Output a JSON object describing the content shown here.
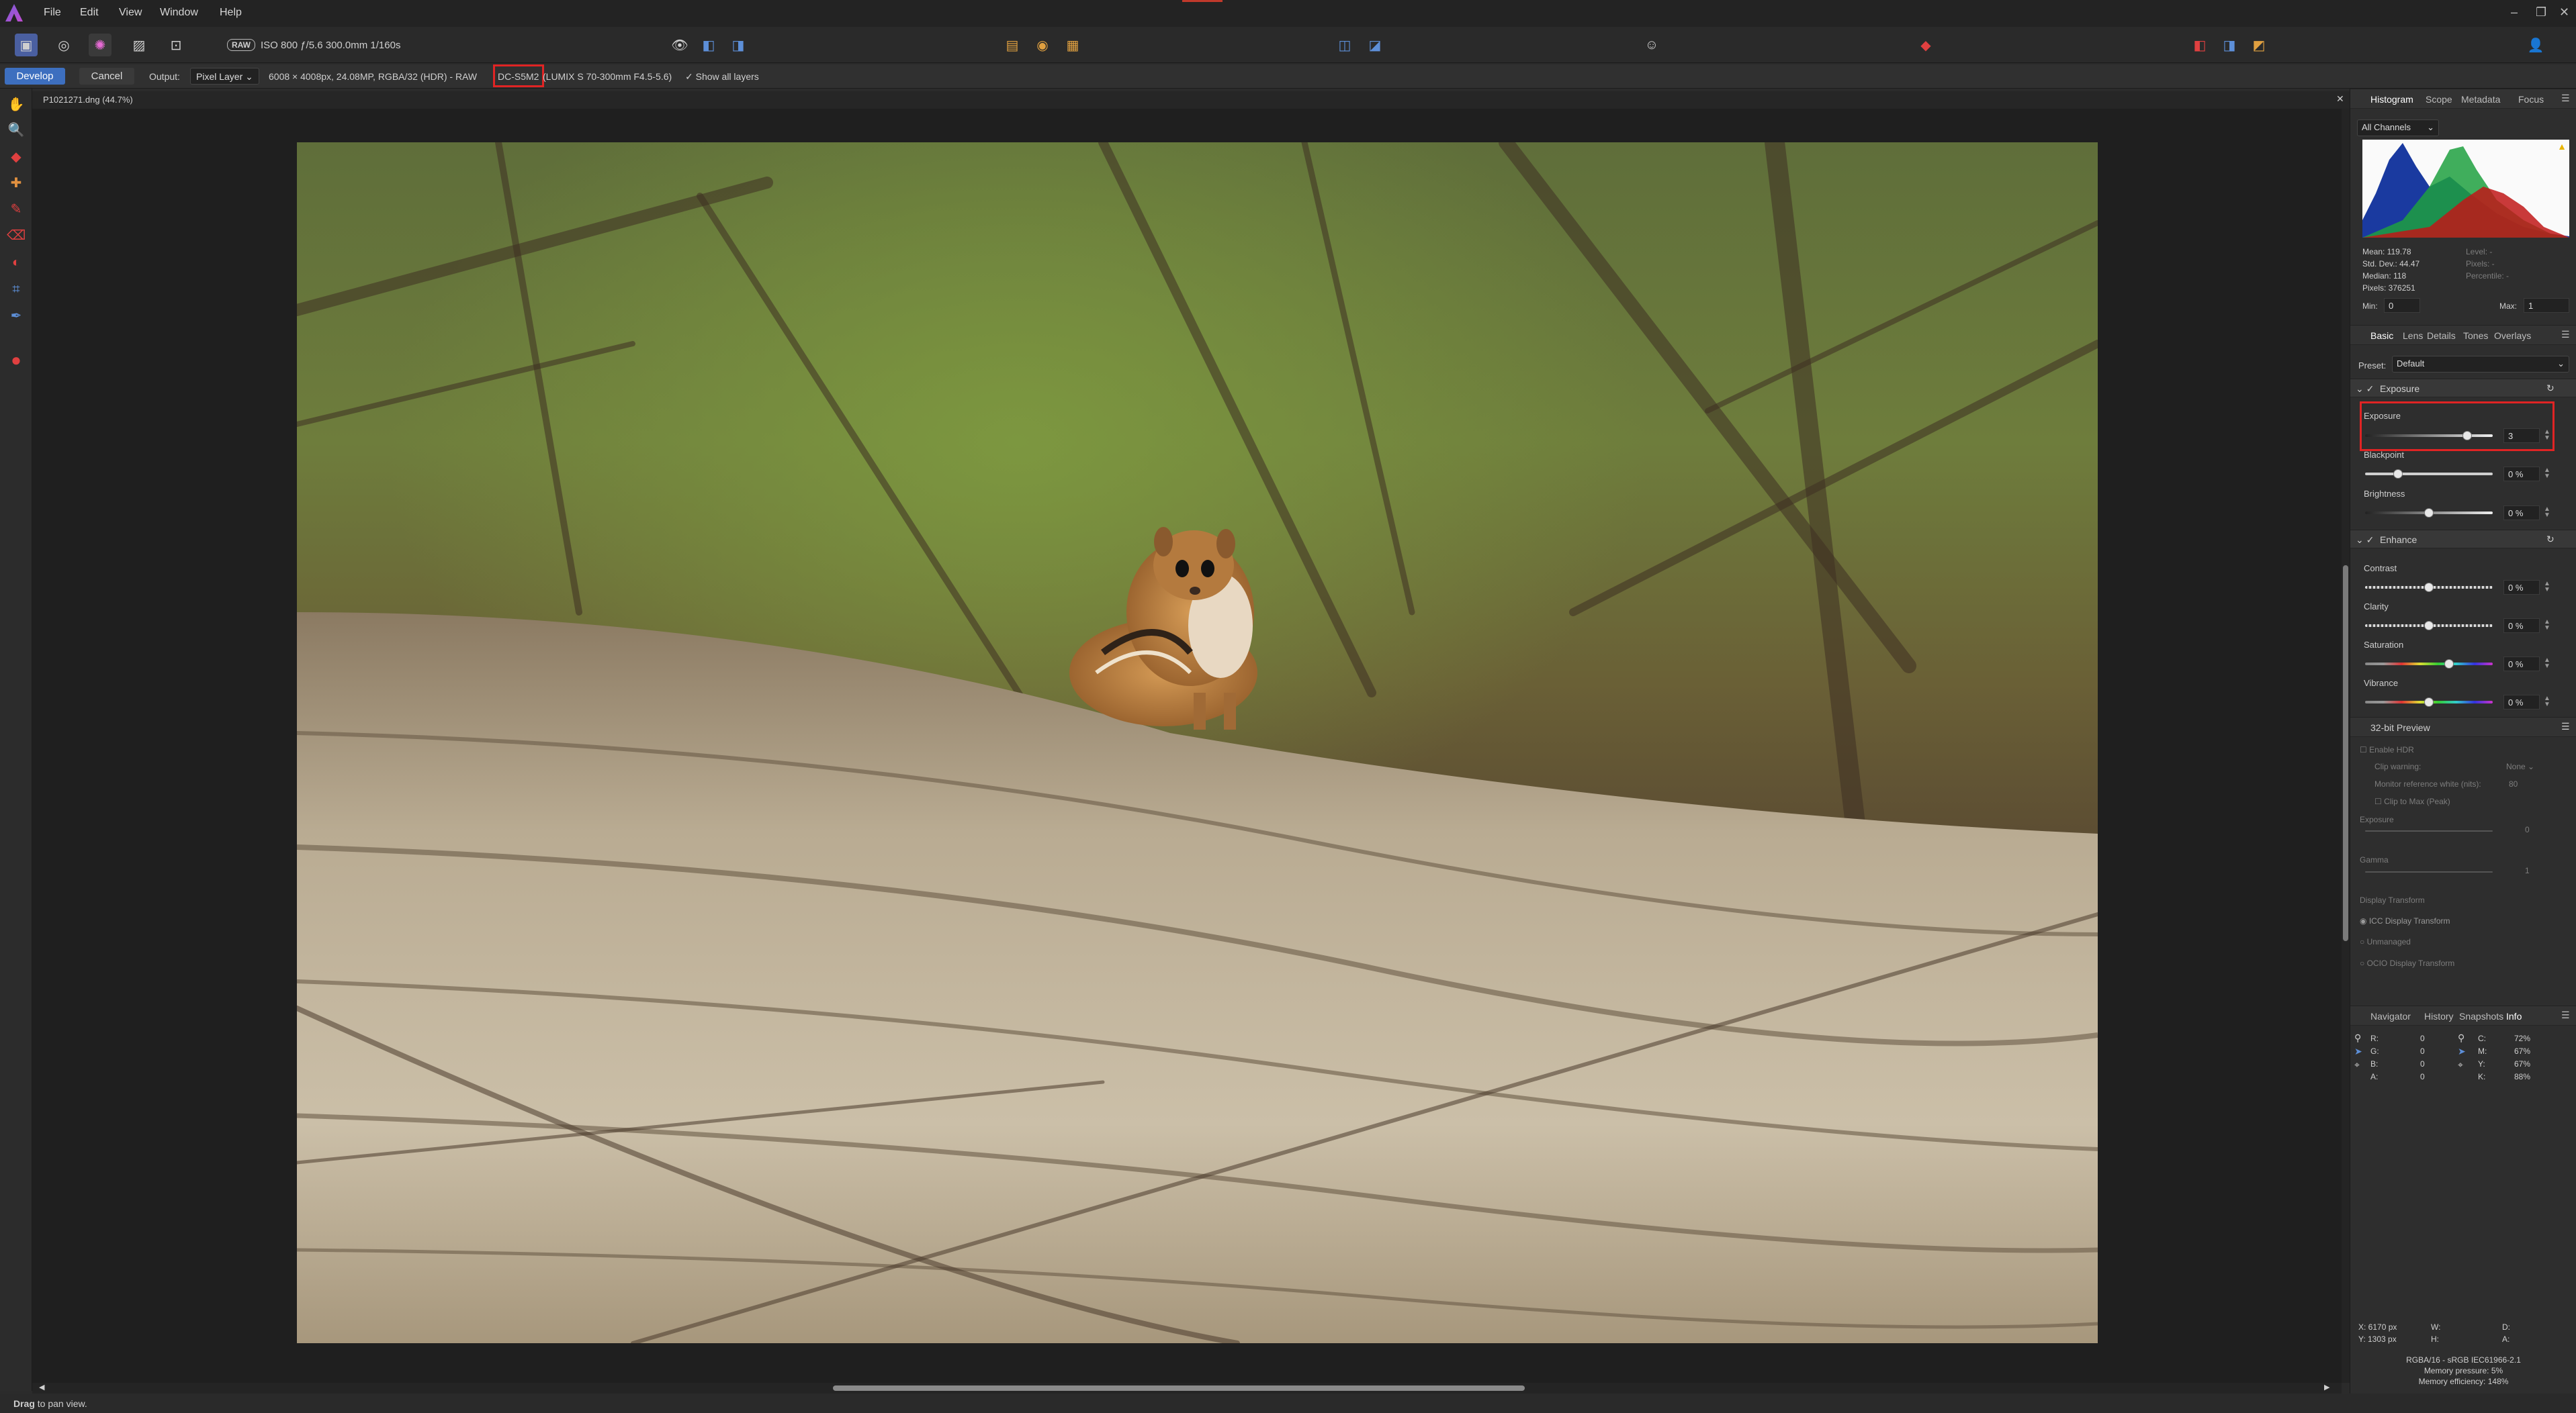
{
  "menu": {
    "items": [
      "File",
      "Edit",
      "View",
      "Window",
      "Help"
    ]
  },
  "toolbar": {
    "raw_badge": "RAW",
    "photo_info": "ISO 800 ƒ/5.6 300.0mm 1/160s"
  },
  "context": {
    "develop_label": "Develop",
    "cancel_label": "Cancel",
    "output_label": "Output:",
    "output_value": "Pixel Layer",
    "image_info": "6008 × 4008px, 24.08MP, RGBA/32 (HDR) - RAW",
    "camera_model": "DC-S5M2",
    "lens_info": "(LUMIX S 70-300mm F4.5-5.6)",
    "show_all_layers": "Show all layers"
  },
  "document": {
    "title": "P1021271.dng (44.7%)"
  },
  "histogram_panel": {
    "tabs": [
      "Histogram",
      "Scope",
      "Metadata",
      "Focus"
    ],
    "active_tab": "Histogram",
    "channel": "All Channels",
    "stats_left": [
      "Mean: 119.78",
      "Std. Dev.: 44.47",
      "Median: 118",
      "Pixels: 376251"
    ],
    "stats_right": [
      "Level: -",
      "Pixels: -",
      "Percentile: -"
    ],
    "min_label": "Min:",
    "min_value": "0",
    "max_label": "Max:",
    "max_value": "1"
  },
  "develop_panel": {
    "tabs": [
      "Basic",
      "Lens",
      "Details",
      "Tones",
      "Overlays"
    ],
    "active_tab": "Basic",
    "preset_label": "Preset:",
    "preset_value": "Default",
    "exposure_group": "Exposure",
    "exposure_label": "Exposure",
    "exposure_value": "3",
    "exposure_level": 0.8,
    "blackpoint_label": "Blackpoint",
    "blackpoint_value": "0 %",
    "brightness_label": "Brightness",
    "brightness_value": "0 %",
    "enhance_group": "Enhance",
    "contrast_label": "Contrast",
    "contrast_value": "0 %",
    "clarity_label": "Clarity",
    "clarity_value": "0 %",
    "saturation_label": "Saturation",
    "saturation_value": "0 %",
    "vibrance_label": "Vibrance",
    "vibrance_value": "0 %"
  },
  "preview_panel": {
    "title": "32-bit Preview",
    "enable_hdr": "Enable HDR",
    "clip_warning_label": "Clip warning:",
    "clip_warning_value": "None",
    "monitor_label": "Monitor reference white (nits):",
    "monitor_value": "80",
    "clip_to_max": "Clip to Max (Peak)",
    "exposure_label": "Exposure",
    "exposure_value": "0",
    "gamma_label": "Gamma",
    "gamma_value": "1",
    "display_transform_label": "Display Transform",
    "icc": "ICC Display Transform",
    "unmanaged": "Unmanaged",
    "ocio": "OCIO Display Transform"
  },
  "info_panel": {
    "tabs": [
      "Navigator",
      "History",
      "Snapshots",
      "Info"
    ],
    "active_tab": "Info",
    "rgb_labels": [
      "R:",
      "G:",
      "B:",
      "A:"
    ],
    "rgb_values": [
      "0",
      "0",
      "0",
      "0"
    ],
    "cmyk_labels": [
      "C:",
      "M:",
      "Y:",
      "K:"
    ],
    "cmyk_values": [
      "72%",
      "67%",
      "67%",
      "88%"
    ],
    "cursor_x": "X: 6170 px",
    "cursor_y": "Y: 1303 px",
    "w_label": "W:",
    "h_label": "H:",
    "d_label": "D:",
    "a_label": "A:",
    "color_profile": "RGBA/16 - sRGB IEC61966-2.1",
    "memory_pressure": "Memory pressure: 5%",
    "memory_efficiency": "Memory efficiency: 148%"
  },
  "status": {
    "bold": "Drag",
    "text": "to pan view."
  },
  "colors": {
    "accent": "#3d6fbf",
    "highlight_box": "#e02424"
  }
}
